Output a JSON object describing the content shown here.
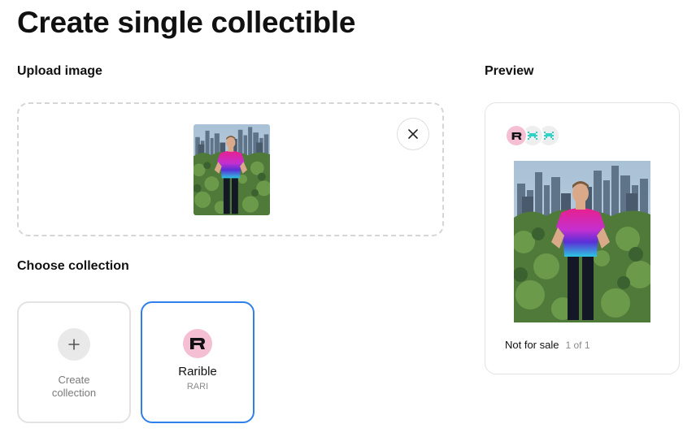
{
  "page": {
    "title": "Create single collectible"
  },
  "upload": {
    "label": "Upload image",
    "thumbnail_icon": "uploaded-photo",
    "remove_icon": "close-icon"
  },
  "collection": {
    "label": "Choose collection",
    "options": [
      {
        "name": "Create collection",
        "line1": "Create",
        "line2": "collection",
        "icon": "plus-icon",
        "selected": false
      },
      {
        "name": "Rarible",
        "symbol": "RARI",
        "icon": "rarible-logo",
        "selected": true
      }
    ]
  },
  "preview": {
    "label": "Preview",
    "status": "Not for sale",
    "edition": "1 of 1",
    "avatars": [
      "rarible-logo",
      "pixel-avatar",
      "pixel-avatar"
    ]
  },
  "colors": {
    "accent": "#2f80ed",
    "rarible_pink": "#f5bfd3",
    "pixel_teal": "#2ed3c6",
    "shirt_magenta": "#e8208c",
    "shirt_purple": "#5a2fd6"
  }
}
